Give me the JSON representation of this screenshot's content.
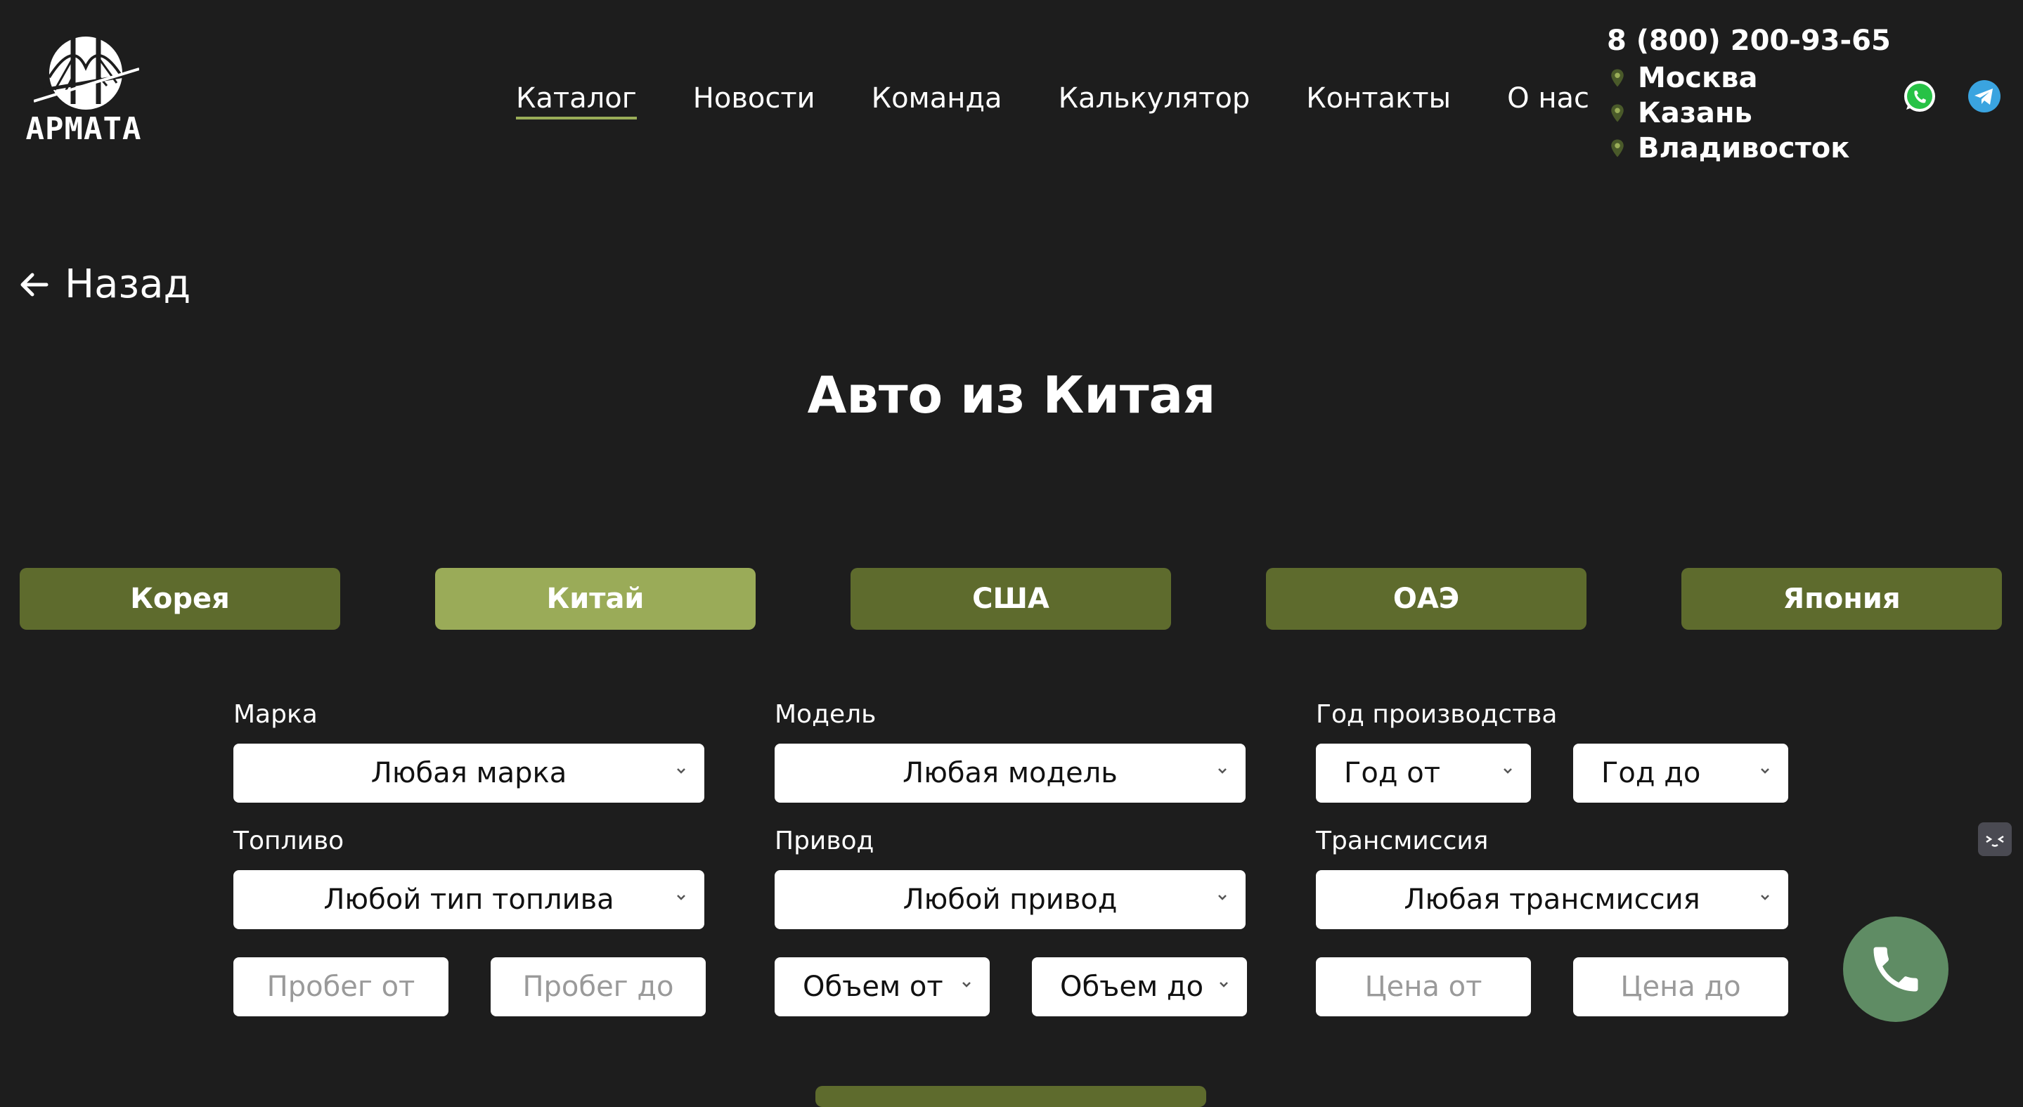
{
  "brand": {
    "logo_text": "АРМАТА"
  },
  "nav": {
    "items": [
      {
        "label": "Каталог",
        "active": true
      },
      {
        "label": "Новости",
        "active": false
      },
      {
        "label": "Команда",
        "active": false
      },
      {
        "label": "Калькулятор",
        "active": false
      },
      {
        "label": "Контакты",
        "active": false
      },
      {
        "label": "О нас",
        "active": false
      }
    ]
  },
  "contacts": {
    "phone": "8 (800) 200-93-65",
    "cities": [
      "Москва",
      "Казань",
      "Владивосток"
    ],
    "pin_color": "#9aad58",
    "social": [
      "whatsapp-icon",
      "telegram-icon"
    ]
  },
  "back": {
    "label": "Назад"
  },
  "page": {
    "title": "Авто из Китая"
  },
  "tabs": [
    {
      "label": "Корея",
      "active": false
    },
    {
      "label": "Китай",
      "active": true
    },
    {
      "label": "США",
      "active": false
    },
    {
      "label": "ОАЭ",
      "active": false
    },
    {
      "label": "Япония",
      "active": false
    }
  ],
  "filters": {
    "brand": {
      "label": "Марка",
      "value": "Любая марка"
    },
    "model": {
      "label": "Модель",
      "value": "Любая модель"
    },
    "year": {
      "label": "Год производства",
      "from": "Год от",
      "to": "Год до"
    },
    "fuel": {
      "label": "Топливо",
      "value": "Любой тип топлива"
    },
    "drive": {
      "label": "Привод",
      "value": "Любой привод"
    },
    "transmission": {
      "label": "Трансмиссия",
      "value": "Любая трансмиссия"
    },
    "mileage": {
      "from_placeholder": "Пробег от",
      "to_placeholder": "Пробег до"
    },
    "volume": {
      "from": "Объем от",
      "to": "Объем до"
    },
    "price": {
      "from_placeholder": "Цена от",
      "to_placeholder": "Цена до"
    }
  },
  "colors": {
    "background": "#1d1d1d",
    "tab": "#5e6b2d",
    "tab_active": "#9aab58",
    "call_button": "#5f8c64"
  }
}
